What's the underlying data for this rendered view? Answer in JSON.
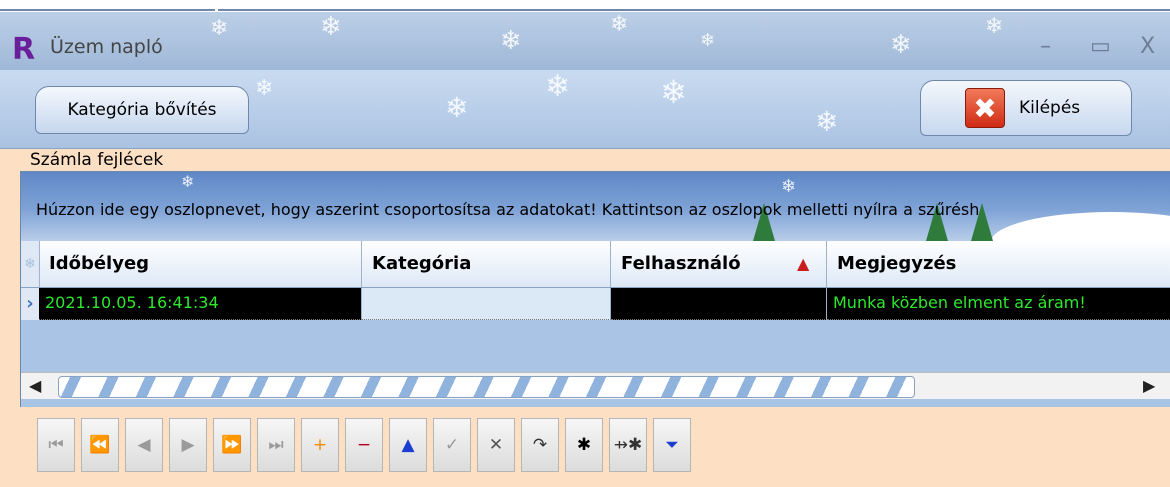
{
  "window": {
    "logo": "R",
    "title": "Üzem napló",
    "controls": {
      "minimize": "–",
      "maximize": "▭",
      "close": "X"
    }
  },
  "toolbar": {
    "kategoria_label": "Kategória bővítés",
    "kilepes_label": "Kilépés",
    "kilepes_icon": "close-icon"
  },
  "group": {
    "label": "Számla fejlécek",
    "grouping_hint": "Húzzon ide egy oszlopnevet, hogy aszerint csoportosítsa az adatokat! Kattintson az oszlopok melletti nyílra a szűrésh"
  },
  "grid": {
    "columns": [
      "Időbélyeg",
      "Kategória",
      "Felhasználó",
      "Megjegyzés"
    ],
    "rows": [
      {
        "idobelyeg": "2021.10.05. 16:41:34",
        "kategoria": "",
        "felhasznalo": "",
        "megjegyzes": "Munka közben elment az áram!"
      }
    ],
    "colors": {
      "row_bg": "#000000",
      "row_text": "#2ee82e",
      "panel_bg": "#a9c4e5",
      "header_bg": "#ffffff"
    }
  },
  "navigator": {
    "buttons": [
      {
        "name": "first",
        "glyph": "⏮",
        "color": "#9a9a9a"
      },
      {
        "name": "prev-page",
        "glyph": "⏪",
        "color": "#9a9a9a"
      },
      {
        "name": "prev",
        "glyph": "◀",
        "color": "#9a9a9a"
      },
      {
        "name": "next",
        "glyph": "▶",
        "color": "#9a9a9a"
      },
      {
        "name": "next-page",
        "glyph": "⏩",
        "color": "#9a9a9a"
      },
      {
        "name": "last",
        "glyph": "⏭",
        "color": "#9a9a9a"
      },
      {
        "name": "insert",
        "glyph": "+",
        "color": "#f08a00"
      },
      {
        "name": "delete",
        "glyph": "−",
        "color": "#b0001c"
      },
      {
        "name": "edit",
        "glyph": "▲",
        "color": "#1d3fd0"
      },
      {
        "name": "post",
        "glyph": "✓",
        "color": "#9a9a9a"
      },
      {
        "name": "cancel",
        "glyph": "✕",
        "color": "#555555"
      },
      {
        "name": "refresh",
        "glyph": "↷",
        "color": "#333333"
      },
      {
        "name": "bookmark",
        "glyph": "✱",
        "color": "#000000"
      },
      {
        "name": "goto-bookmark",
        "glyph": "⇸✱",
        "color": "#333333"
      },
      {
        "name": "filter",
        "glyph": "⏷",
        "color": "#1d3fd0"
      }
    ]
  }
}
